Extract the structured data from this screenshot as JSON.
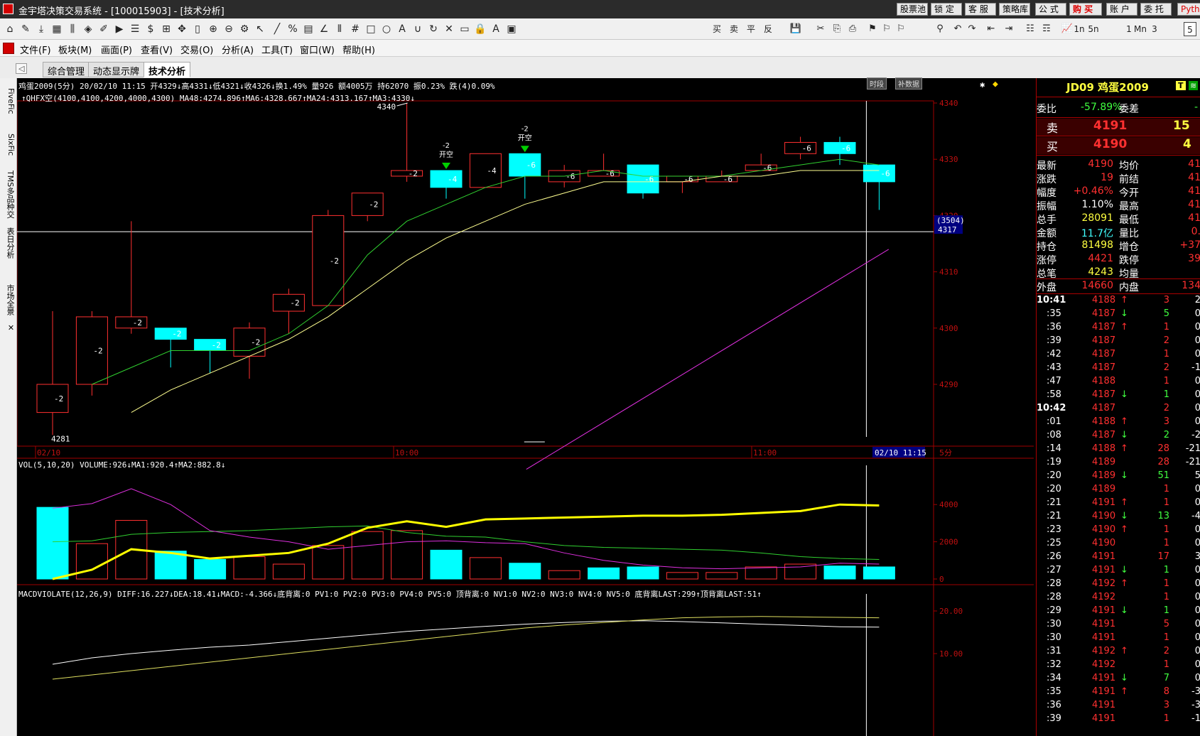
{
  "window": {
    "title": "金宇塔决策交易系统 - [100015903] - [技术分析]",
    "buttons": [
      "股票池",
      "锁 定",
      "客 服",
      "策略库",
      "公 式",
      "购 买",
      "账 户",
      "委 托",
      "Pyth"
    ]
  },
  "menu": [
    "文件(F)",
    "板块(M)",
    "画面(P)",
    "查看(V)",
    "交易(O)",
    "分析(A)",
    "工具(T)",
    "窗口(W)",
    "帮助(H)"
  ],
  "tabs": [
    "综合管理",
    "动态显示牌",
    "技术分析"
  ],
  "left_strip": [
    "FiveFic",
    "SixFic",
    "TMS多品种交",
    "表日分析",
    "市场全景"
  ],
  "toolbar_labels": [
    "买",
    "卖",
    "平",
    "反",
    "1n",
    "5n",
    "1",
    "Mn",
    "3",
    "5"
  ],
  "chart": {
    "header1": "鸡蛋2009(5分) 20/02/10 11:15 开4329↓高4331↓低4321↓收4326↓换1.49% 量926 额4005万 持62070 振0.23% 跌(4)0.09%",
    "header2": "↑QHFX空(4100,4100,4200,4000,4300) MA48:4274.896↑MA6:4328.667↑MA24:4313.167↑MA3:4330↓",
    "badges": [
      "时段",
      "补数据"
    ],
    "cross_price": "4317",
    "cross_vol": "(3504)",
    "label_4340": "4340",
    "label_4281": "4281",
    "times": [
      "02/10",
      "10:00",
      "11:00"
    ],
    "cursor_time": "02/10 11:15",
    "period": "5分",
    "vol_header": "VOL(5,10,20) VOLUME:926↓MA1:920.4↑MA2:882.8↓",
    "macd_header": "MACDVIOLATE(12,26,9) DIFF:16.227↓DEA:18.41↓MACD:-4.366↓底背离:0 PV1:0 PV2:0 PV3:0 PV4:0 PV5:0 顶背离:0 NV1:0 NV2:0 NV3:0 NV4:0 NV5:0 底背离LAST:299↑顶背离LAST:51↑",
    "price_ticks": [
      "4340",
      "4330",
      "4320",
      "4310",
      "4300",
      "4290"
    ],
    "vol_ticks": [
      "4000",
      "2000",
      "0"
    ],
    "macd_ticks": [
      "20.00",
      "10.00"
    ],
    "signals": [
      {
        "text": "-2 开空",
        "bar": 10
      },
      {
        "text": "-2 开空",
        "bar": 12
      }
    ]
  },
  "chart_data": {
    "type": "candlestick",
    "candles": [
      {
        "o": 4285,
        "c": 4290,
        "h": 4303,
        "l": 4281,
        "lbl": "-2"
      },
      {
        "o": 4290,
        "c": 4302,
        "h": 4303,
        "l": 4288,
        "lbl": "-2"
      },
      {
        "o": 4300,
        "c": 4302,
        "h": 4319,
        "l": 4299,
        "lbl": "-2"
      },
      {
        "o": 4300,
        "c": 4298,
        "h": 4300,
        "l": 4293,
        "lbl": "-2"
      },
      {
        "o": 4298,
        "c": 4296,
        "h": 4298,
        "l": 4292,
        "lbl": "-2"
      },
      {
        "o": 4295,
        "c": 4300,
        "h": 4301,
        "l": 4291,
        "lbl": "-2"
      },
      {
        "o": 4303,
        "c": 4306,
        "h": 4307,
        "l": 4299,
        "lbl": "-2"
      },
      {
        "o": 4304,
        "c": 4320,
        "h": 4321,
        "l": 4304,
        "lbl": "-2"
      },
      {
        "o": 4320,
        "c": 4324,
        "h": 4324,
        "l": 4319,
        "lbl": "-2"
      },
      {
        "o": 4327,
        "c": 4328,
        "h": 4340,
        "l": 4326,
        "lbl": "-2"
      },
      {
        "o": 4328,
        "c": 4325,
        "h": 4327,
        "l": 4323,
        "lbl": "-4"
      },
      {
        "o": 4325,
        "c": 4331,
        "h": 4331,
        "l": 4325,
        "lbl": "-4"
      },
      {
        "o": 4331,
        "c": 4327,
        "h": 4329,
        "l": 4323,
        "lbl": "-6"
      },
      {
        "o": 4326,
        "c": 4328,
        "h": 4329,
        "l": 4325,
        "lbl": "-6"
      },
      {
        "o": 4327,
        "c": 4328,
        "h": 4331,
        "l": 4327,
        "lbl": "-6"
      },
      {
        "o": 4329,
        "c": 4324,
        "h": 4329,
        "l": 4323,
        "lbl": "-6"
      },
      {
        "o": 4326,
        "c": 4327,
        "h": 4327,
        "l": 4324,
        "lbl": "-6"
      },
      {
        "o": 4326,
        "c": 4327,
        "h": 4328,
        "l": 4326,
        "lbl": "-6"
      },
      {
        "o": 4328,
        "c": 4329,
        "h": 4331,
        "l": 4328,
        "lbl": "-6"
      },
      {
        "o": 4331,
        "c": 4333,
        "h": 4334,
        "l": 4330,
        "lbl": "-6"
      },
      {
        "o": 4333,
        "c": 4331,
        "h": 4334,
        "l": 4329,
        "lbl": "-6"
      },
      {
        "o": 4329,
        "c": 4326,
        "h": 4329,
        "l": 4321,
        "lbl": "-6"
      }
    ],
    "ma_green": [
      null,
      4290,
      4293,
      4296,
      4296,
      4296,
      4299,
      4304,
      4313,
      4319,
      4322,
      4325,
      4327,
      4327,
      4328,
      4327,
      4327,
      4327,
      4328,
      4329,
      4330,
      4329
    ],
    "ma_yellow": [
      null,
      null,
      4285,
      4289,
      4292,
      4295,
      4298,
      4302,
      4307,
      4312,
      4316,
      4319,
      4322,
      4324,
      4326,
      4326,
      4326,
      4327,
      4327,
      4328,
      4328,
      4328
    ],
    "ma_magenta_x": [
      12,
      22
    ],
    "ma_magenta_y": [
      4285,
      4314
    ],
    "volume": [
      {
        "v": 3850,
        "up": false
      },
      {
        "v": 1900,
        "up": true
      },
      {
        "v": 3150,
        "up": true
      },
      {
        "v": 1500,
        "up": false
      },
      {
        "v": 1050,
        "up": false
      },
      {
        "v": 1200,
        "up": true
      },
      {
        "v": 800,
        "up": true
      },
      {
        "v": 1800,
        "up": true
      },
      {
        "v": 2550,
        "up": true
      },
      {
        "v": 2600,
        "up": true
      },
      {
        "v": 1550,
        "up": false
      },
      {
        "v": 1150,
        "up": true
      },
      {
        "v": 850,
        "up": false
      },
      {
        "v": 450,
        "up": true
      },
      {
        "v": 600,
        "up": false
      },
      {
        "v": 650,
        "up": false
      },
      {
        "v": 350,
        "up": true
      },
      {
        "v": 350,
        "up": true
      },
      {
        "v": 650,
        "up": true
      },
      {
        "v": 800,
        "up": true
      },
      {
        "v": 700,
        "up": false
      },
      {
        "v": 650,
        "up": false
      }
    ],
    "vol_ma_yellow": [
      0,
      500,
      1600,
      1400,
      1100,
      1250,
      1400,
      1900,
      2750,
      3100,
      2800,
      3200,
      3250,
      3300,
      3350,
      3400,
      3400,
      3450,
      3550,
      3650,
      4000,
      3950
    ],
    "vol_ma_magenta": [
      3800,
      4050,
      4850,
      4000,
      2600,
      2250,
      2000,
      1600,
      1800,
      2000,
      2050,
      1950,
      1900,
      1400,
      1000,
      750,
      600,
      550,
      600,
      650,
      850,
      800
    ],
    "vol_ma_green": [
      2000,
      2050,
      2400,
      2500,
      2550,
      2600,
      2700,
      2800,
      2850,
      2500,
      2300,
      2250,
      2000,
      1800,
      1700,
      1650,
      1600,
      1550,
      1400,
      1200,
      1100,
      1050
    ],
    "macd_white": [
      7.5,
      9,
      10,
      10.8,
      11.5,
      12,
      12.8,
      13.6,
      14.4,
      15.2,
      15.8,
      16.4,
      16.9,
      17.3,
      17.6,
      17.7,
      17.5,
      17.2,
      16.9,
      16.6,
      16.3,
      16.2
    ],
    "macd_yellow": [
      4,
      5,
      6,
      7,
      8,
      9,
      10,
      11,
      12,
      13,
      14,
      15,
      16,
      16.7,
      17.3,
      17.9,
      18.4,
      18.6,
      18.7,
      18.6,
      18.5,
      18.4
    ],
    "macd_bars": [
      -2.5,
      -3,
      -2.6,
      -2.8,
      -3.2,
      -3,
      -2.7,
      -2.2,
      -1.8,
      -1.4,
      -1.4,
      -1.4,
      -1.6,
      -2.2,
      -2.6,
      -2.9,
      -3.2,
      -3.5,
      -3.8,
      -4,
      -4.2,
      -4.366
    ]
  },
  "quote": {
    "code_name": "JD09 鸡蛋2009",
    "weibi_label": "委比",
    "weibi": "-57.89%",
    "weicha_label": "委差",
    "sell_label": "卖",
    "sell_price": "4191",
    "sell_vol": "15",
    "buy_label": "买",
    "buy_price": "4190",
    "buy_vol": "4",
    "rows": [
      {
        "l1": "最新",
        "v1": "4190",
        "l2": "均价",
        "v2": "41",
        "c1": "#ff3030"
      },
      {
        "l1": "涨跌",
        "v1": "19",
        "l2": "前结",
        "v2": "41",
        "c1": "#ff3030"
      },
      {
        "l1": "幅度",
        "v1": "+0.46%",
        "l2": "今开",
        "v2": "41",
        "c1": "#ff3030"
      },
      {
        "l1": "振幅",
        "v1": "1.10%",
        "l2": "最高",
        "v2": "41",
        "c1": "#ffffff"
      },
      {
        "l1": "总手",
        "v1": "28091",
        "l2": "最低",
        "v2": "41",
        "c1": "#ffff40"
      },
      {
        "l1": "金额",
        "v1": "11.7亿",
        "l2": "量比",
        "v2": "0.",
        "c1": "#40ffff"
      },
      {
        "l1": "持仓",
        "v1": "81498",
        "l2": "增仓",
        "v2": "+37",
        "c1": "#ffff40"
      },
      {
        "l1": "涨停",
        "v1": "4421",
        "l2": "跌停",
        "v2": "39",
        "c1": "#ff3030"
      },
      {
        "l1": "总笔",
        "v1": "4243",
        "l2": "均量",
        "v2": "",
        "c1": "#ffff40"
      },
      {
        "l1": "外盘",
        "v1": "14660",
        "l2": "内盘",
        "v2": "134",
        "c1": "#ff3030"
      }
    ],
    "ticks": [
      {
        "t": "10:41",
        "p": "4188",
        "a": "↑",
        "v": "3",
        "z": "2"
      },
      {
        "t": ":35",
        "p": "4187",
        "a": "↓",
        "v": "5",
        "z": "0"
      },
      {
        "t": ":36",
        "p": "4187",
        "a": "↑",
        "v": "1",
        "z": "0"
      },
      {
        "t": ":39",
        "p": "4187",
        "a": "",
        "v": "2",
        "z": "0"
      },
      {
        "t": ":42",
        "p": "4187",
        "a": "",
        "v": "1",
        "z": "0"
      },
      {
        "t": ":43",
        "p": "4187",
        "a": "",
        "v": "2",
        "z": "-1"
      },
      {
        "t": ":47",
        "p": "4188",
        "a": "",
        "v": "1",
        "z": "0"
      },
      {
        "t": ":58",
        "p": "4187",
        "a": "↓",
        "v": "1",
        "z": "0"
      },
      {
        "t": "10:42",
        "p": "4187",
        "a": "",
        "v": "2",
        "z": "0"
      },
      {
        "t": ":01",
        "p": "4188",
        "a": "↑",
        "v": "3",
        "z": "0"
      },
      {
        "t": ":08",
        "p": "4187",
        "a": "↓",
        "v": "2",
        "z": "-2"
      },
      {
        "t": ":14",
        "p": "4188",
        "a": "↑",
        "v": "28",
        "z": "-21"
      },
      {
        "t": ":19",
        "p": "4189",
        "a": "",
        "v": "28",
        "z": "-21"
      },
      {
        "t": ":20",
        "p": "4189",
        "a": "↓",
        "v": "51",
        "z": "5"
      },
      {
        "t": ":20",
        "p": "4189",
        "a": "",
        "v": "1",
        "z": "0"
      },
      {
        "t": ":21",
        "p": "4191",
        "a": "↑",
        "v": "1",
        "z": "0"
      },
      {
        "t": ":21",
        "p": "4190",
        "a": "↓",
        "v": "13",
        "z": "-4"
      },
      {
        "t": ":23",
        "p": "4190",
        "a": "↑",
        "v": "1",
        "z": "0"
      },
      {
        "t": ":25",
        "p": "4190",
        "a": "",
        "v": "1",
        "z": "0"
      },
      {
        "t": ":26",
        "p": "4191",
        "a": "",
        "v": "17",
        "z": "3"
      },
      {
        "t": ":27",
        "p": "4191",
        "a": "↓",
        "v": "1",
        "z": "0"
      },
      {
        "t": ":28",
        "p": "4192",
        "a": "↑",
        "v": "1",
        "z": "0"
      },
      {
        "t": ":28",
        "p": "4192",
        "a": "",
        "v": "1",
        "z": "0"
      },
      {
        "t": ":29",
        "p": "4191",
        "a": "↓",
        "v": "1",
        "z": "0"
      },
      {
        "t": ":30",
        "p": "4191",
        "a": "",
        "v": "5",
        "z": "0"
      },
      {
        "t": ":30",
        "p": "4191",
        "a": "",
        "v": "1",
        "z": "0"
      },
      {
        "t": ":31",
        "p": "4192",
        "a": "↑",
        "v": "2",
        "z": "0"
      },
      {
        "t": ":32",
        "p": "4192",
        "a": "",
        "v": "1",
        "z": "0"
      },
      {
        "t": ":34",
        "p": "4191",
        "a": "↓",
        "v": "7",
        "z": "0"
      },
      {
        "t": ":35",
        "p": "4191",
        "a": "↑",
        "v": "8",
        "z": "-3"
      },
      {
        "t": ":36",
        "p": "4191",
        "a": "",
        "v": "3",
        "z": "-3"
      },
      {
        "t": ":39",
        "p": "4191",
        "a": "",
        "v": "1",
        "z": "-1"
      }
    ]
  }
}
